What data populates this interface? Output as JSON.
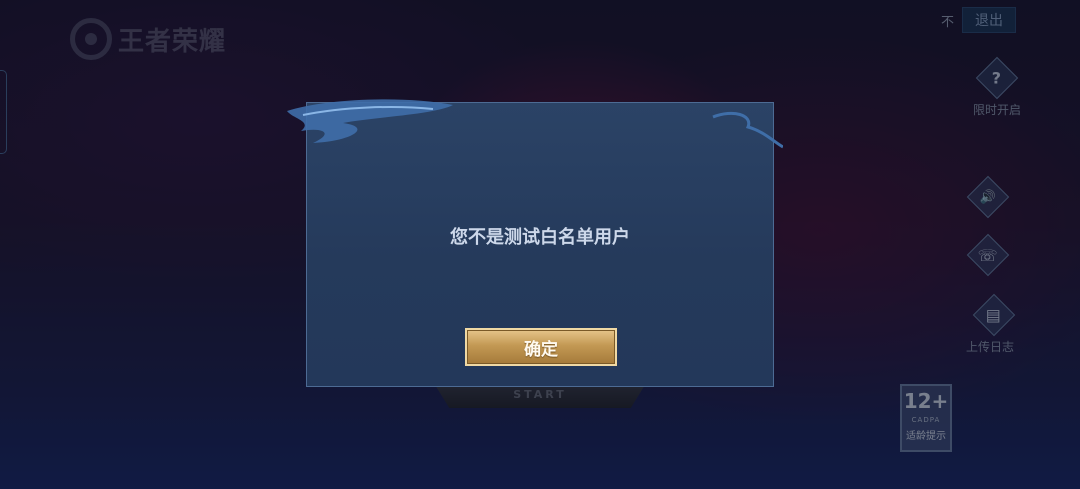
{
  "header": {
    "logo_text": "王者荣耀",
    "no_label": "不",
    "exit_label": "退出"
  },
  "sidebar": {
    "items": [
      {
        "icon": "question-icon",
        "glyph": "?",
        "label": "限时开启"
      },
      {
        "icon": "speaker-icon",
        "glyph": "🔊",
        "label": ""
      },
      {
        "icon": "phone-icon",
        "glyph": "☏",
        "label": ""
      },
      {
        "icon": "clipboard-icon",
        "glyph": "▤",
        "label": "上传日志"
      }
    ]
  },
  "start": {
    "label": "START"
  },
  "age_rating": {
    "number": "12+",
    "org": "CADPA",
    "note": "适龄提示"
  },
  "dialog": {
    "message": "您不是测试白名单用户",
    "confirm_label": "确定"
  },
  "colors": {
    "dialog_bg": "#2b4366",
    "confirm_gold": "#c39954",
    "accent_blue": "#4d6b94"
  }
}
